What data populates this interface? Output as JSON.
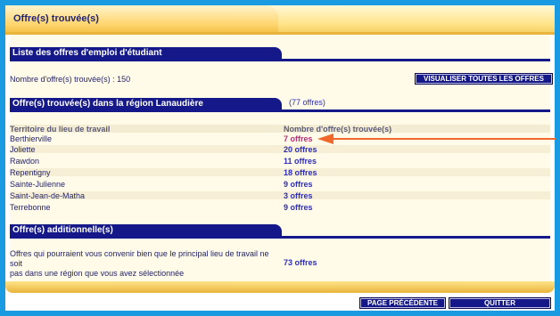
{
  "page": {
    "title": "Offre(s) trouvée(s)"
  },
  "list_section": {
    "heading": "Liste des offres d'emploi d'étudiant",
    "count_label": "Nombre d'offre(s) trouvée(s) : 150",
    "view_all_button": "VISUALISER TOUTES LES OFFRES"
  },
  "region_section": {
    "heading": "Offre(s) trouvée(s) dans la région Lanaudière",
    "total_link": "(77 offres)",
    "col_territory": "Territoire du lieu de travail",
    "col_count": "Nombre d'offre(s) trouvée(s)",
    "rows": [
      {
        "territory": "Berthierville",
        "count": "7 offres"
      },
      {
        "territory": "Joliette",
        "count": "20 offres"
      },
      {
        "territory": "Rawdon",
        "count": "11 offres"
      },
      {
        "territory": "Repentigny",
        "count": "18 offres"
      },
      {
        "territory": "Sainte-Julienne",
        "count": "9 offres"
      },
      {
        "territory": "Saint-Jean-de-Matha",
        "count": "3 offres"
      },
      {
        "territory": "Terrebonne",
        "count": "9 offres"
      }
    ]
  },
  "additional_section": {
    "heading": "Offre(s) additionnelle(s)",
    "description_line1": "Offres qui pourraient vous convenir bien que le principal lieu de travail ne soit",
    "description_line2": "pas dans une région que vous avez sélectionnée",
    "count_link": "73 offres"
  },
  "footer": {
    "previous_button": "PAGE PRÉCÉDENTE",
    "quit_button": "QUITTER"
  },
  "colors": {
    "accent_navy": "#151888",
    "highlight_link": "#b32f7a",
    "annotation_arrow": "#f0682a"
  }
}
